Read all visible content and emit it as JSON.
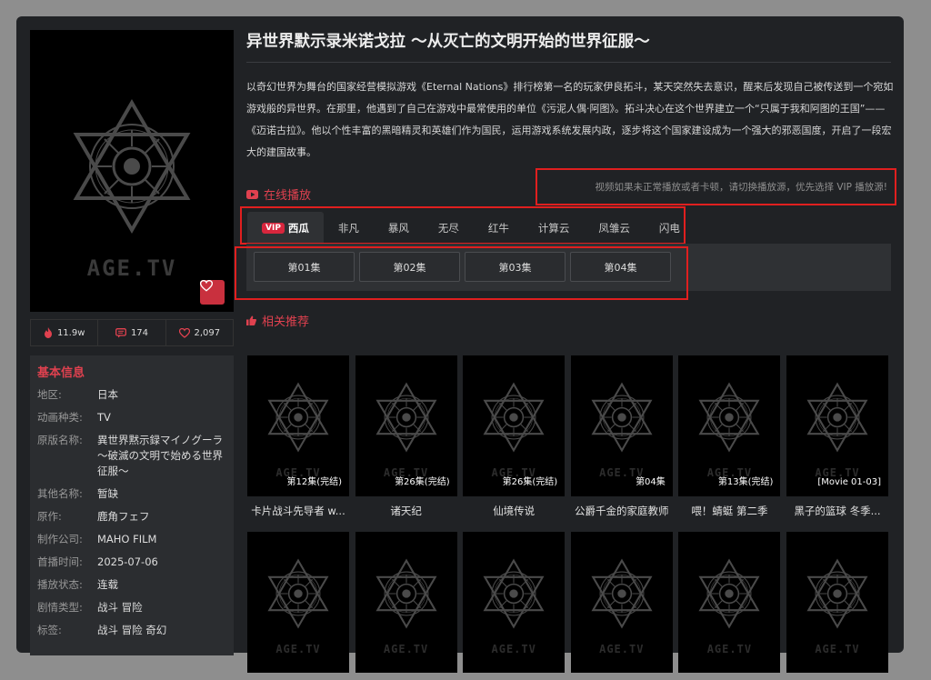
{
  "anime": {
    "title": "异世界默示录米诺戈拉 〜从灭亡的文明开始的世界征服〜",
    "description": "以奇幻世界为舞台的国家经营模拟游戏《Eternal Nations》排行榜第一名的玩家伊良拓斗，某天突然失去意识，醒来后发现自己被传送到一个宛如游戏般的异世界。在那里，他遇到了自己在游戏中最常使用的单位《污泥人偶·阿图》。拓斗决心在这个世界建立一个“只属于我和阿图的王国”——《迈诺古拉》。他以个性丰富的黑暗精灵和英雄们作为国民，运用游戏系统发展内政，逐步将这个国家建设成为一个强大的邪恶国度，开启了一段宏大的建国故事。",
    "cover_logo": "AGE.TV",
    "stats": {
      "views": "11.9w",
      "comments": "174",
      "favorites": "2,097"
    }
  },
  "info": {
    "heading": "基本信息",
    "rows": [
      {
        "k": "地区:",
        "v": "日本"
      },
      {
        "k": "动画种类:",
        "v": "TV"
      },
      {
        "k": "原版名称:",
        "v": "異世界黙示録マイノグーラ 〜破滅の文明で始める世界征服〜"
      },
      {
        "k": "其他名称:",
        "v": "暂缺"
      },
      {
        "k": "原作:",
        "v": "鹿角フェフ"
      },
      {
        "k": "制作公司:",
        "v": "MAHO FILM"
      },
      {
        "k": "首播时间:",
        "v": "2025-07-06"
      },
      {
        "k": "播放状态:",
        "v": "连载"
      },
      {
        "k": "剧情类型:",
        "v": "战斗 冒险"
      },
      {
        "k": "标签:",
        "v": "战斗 冒险 奇幻"
      }
    ]
  },
  "online": {
    "heading": "在线播放",
    "notice": "视频如果未正常播放或者卡顿，请切换播放源，优先选择 VIP 播放源!",
    "vip_label": "VIP",
    "sources": [
      "西瓜",
      "非凡",
      "暴风",
      "无尽",
      "红牛",
      "计算云",
      "凤雏云",
      "闪电"
    ],
    "episodes": [
      "第01集",
      "第02集",
      "第03集",
      "第04集"
    ]
  },
  "related": {
    "heading": "相关推荐",
    "watermark": "AGE.TV",
    "items": [
      {
        "name": "卡片战斗先导者 w...",
        "badge": "第12集(完结)"
      },
      {
        "name": "诸天纪",
        "badge": "第26集(完结)"
      },
      {
        "name": "仙境传说",
        "badge": "第26集(完结)"
      },
      {
        "name": "公爵千金的家庭教师",
        "badge": "第04集"
      },
      {
        "name": "喂！蜻蜓 第二季",
        "badge": "第13集(完结)"
      },
      {
        "name": "黑子的篮球 冬季...",
        "badge": "[Movie 01-03]"
      },
      {
        "name": "",
        "badge": ""
      },
      {
        "name": "",
        "badge": ""
      },
      {
        "name": "",
        "badge": ""
      },
      {
        "name": "",
        "badge": ""
      },
      {
        "name": "",
        "badge": ""
      },
      {
        "name": "",
        "badge": ""
      }
    ]
  },
  "colors": {
    "accent": "#e0414f",
    "highlight_box": "#e01f1f",
    "panel": "#202225"
  }
}
